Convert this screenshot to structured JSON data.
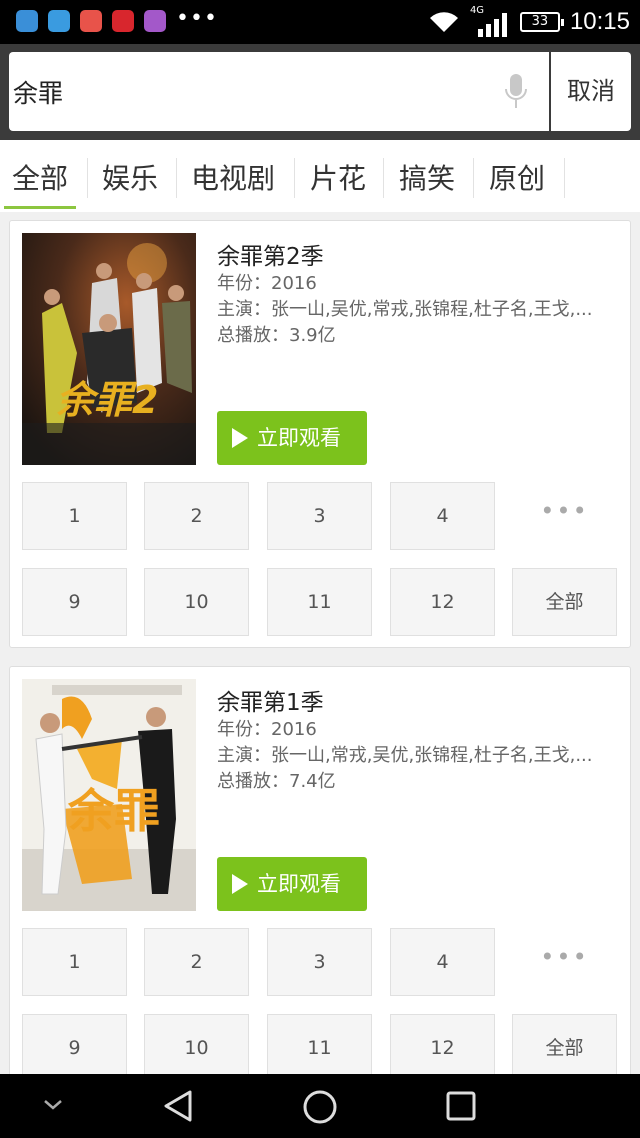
{
  "status_bar": {
    "time": "10:15",
    "battery": "33",
    "network": "4G",
    "app_icon_colors": [
      "#3a8fd8",
      "#3a9be0",
      "#e8534a",
      "#d8262d",
      "#a358c9"
    ]
  },
  "search": {
    "query": "余罪",
    "cancel_label": "取消"
  },
  "tabs": [
    "全部",
    "娱乐",
    "电视剧",
    "片花",
    "搞笑",
    "原创"
  ],
  "accent_color": "#8cc63f",
  "results": [
    {
      "title": "余罪第2季",
      "year": "年份：2016",
      "cast": "主演：张一山,吴优,常戎,张锦程,杜子名,王戈,...",
      "plays": "总播放：3.9亿",
      "play_label": "立即观看",
      "poster_text": "余罪2",
      "episodes_row1": [
        "1",
        "2",
        "3",
        "4"
      ],
      "more_label": "•••",
      "episodes_row2": [
        "9",
        "10",
        "11",
        "12"
      ],
      "all_label": "全部"
    },
    {
      "title": "余罪第1季",
      "year": "年份：2016",
      "cast": "主演：张一山,常戎,吴优,张锦程,杜子名,王戈,...",
      "plays": "总播放：7.4亿",
      "play_label": "立即观看",
      "poster_text": "余罪",
      "episodes_row1": [
        "1",
        "2",
        "3",
        "4"
      ],
      "more_label": "•••",
      "episodes_row2": [
        "9",
        "10",
        "11",
        "12"
      ],
      "all_label": "全部"
    }
  ]
}
